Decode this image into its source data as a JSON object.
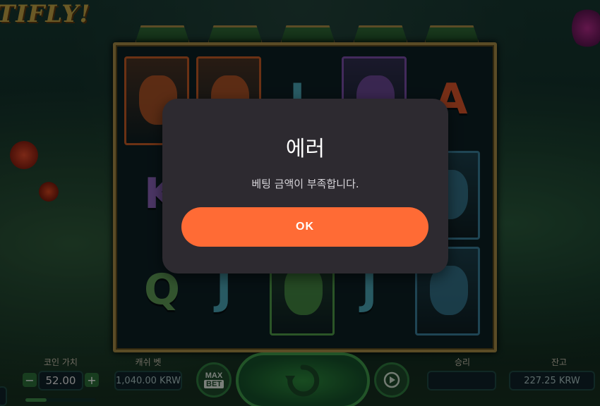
{
  "game": {
    "logo_text": "TIFLY!"
  },
  "reels": [
    [
      {
        "type": "parrot",
        "color": "#c45a25"
      },
      {
        "type": "letter",
        "text": "K",
        "color": "#8a62b8"
      },
      {
        "type": "letter",
        "text": "Q",
        "color": "#5d9a55"
      }
    ],
    [
      {
        "type": "parrot",
        "color": "#c45a25"
      },
      {
        "type": "blank"
      },
      {
        "type": "letter",
        "text": "J",
        "color": "#4aa5b5"
      }
    ],
    [
      {
        "type": "letter",
        "text": "J",
        "color": "#4aa5b5"
      },
      {
        "type": "blank"
      },
      {
        "type": "frog",
        "color": "#4f9c48"
      }
    ],
    [
      {
        "type": "bird",
        "color": "#7a4ea8"
      },
      {
        "type": "blank"
      },
      {
        "type": "letter",
        "text": "J",
        "color": "#4aa5b5"
      }
    ],
    [
      {
        "type": "letter",
        "text": "A",
        "color": "#d9552a"
      },
      {
        "type": "frog",
        "color": "#3a7f9a"
      },
      {
        "type": "frog",
        "color": "#3a7f9a"
      }
    ]
  ],
  "dialog": {
    "title": "에러",
    "message": "베팅 금액이 부족합니다.",
    "ok_label": "OK"
  },
  "controls": {
    "coin_value_label": "코인 가치",
    "coin_value": "52.00",
    "bet_label": "캐쉬 벳",
    "bet_value": "1,040.00 KRW",
    "max_bet_line1": "MAX",
    "max_bet_line2": "BET",
    "win_label": "승리",
    "win_value": "",
    "balance_label": "잔고",
    "balance_value": "227.25 KRW",
    "minus": "−",
    "plus": "+"
  },
  "icons": {
    "spin": "spin-arrow-icon",
    "autoplay": "autoplay-icon"
  }
}
